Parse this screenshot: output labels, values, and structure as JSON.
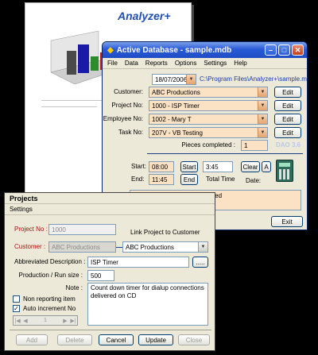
{
  "report": {
    "logo": "Analyzer+"
  },
  "db_window": {
    "title": "Active Database - sample.mdb",
    "menu": [
      "File",
      "Data",
      "Reports",
      "Options",
      "Settings",
      "Help"
    ],
    "date": "18/07/2006",
    "path": "C:\\Program Files\\Analyzer+\\sample.mdb",
    "labels": {
      "customer": "Customer:",
      "project": "Project No:",
      "employee": "Employee No:",
      "task": "Task No:",
      "pieces": "Pieces completed :",
      "start": "Start:",
      "end": "End:",
      "total_time": "Total Time",
      "date": "Date:",
      "dao": "DAO 3.6"
    },
    "values": {
      "customer": "ABC Productions",
      "project": "1000 - ISP Timer",
      "employee": "1002 - Mary T",
      "task": "207V - VB Testing",
      "pieces": "1",
      "start": "08:00",
      "end": "11:45",
      "total": "3:45",
      "note": "Final application test completed"
    },
    "buttons": {
      "edit": "Edit",
      "start": "Start",
      "end": "End",
      "clear": "Clear",
      "a": "A",
      "exit": "Exit"
    }
  },
  "projects_window": {
    "title": "Projects",
    "menu": [
      "Settings"
    ],
    "labels": {
      "project": "Project No :",
      "customer": "Customer :",
      "link": "Link Project to Customer",
      "abbrev": "Abbreviated Description :",
      "production": "Production / Run size :",
      "note": "Note :",
      "non_reporting": "Non reporting item",
      "auto_inc": "Auto increment No"
    },
    "values": {
      "project": "1000",
      "customer_ro": "ABC Productions",
      "customer_link": "ABC Productions",
      "abbrev": "ISP Timer",
      "production": "500",
      "note": "Count down timer for dialup connections delivered on CD",
      "nav_record": "1",
      "browse": "....."
    },
    "buttons": {
      "add": "Add",
      "delete": "Delete",
      "cancel": "Cancel",
      "update": "Update",
      "close": "Close"
    }
  }
}
